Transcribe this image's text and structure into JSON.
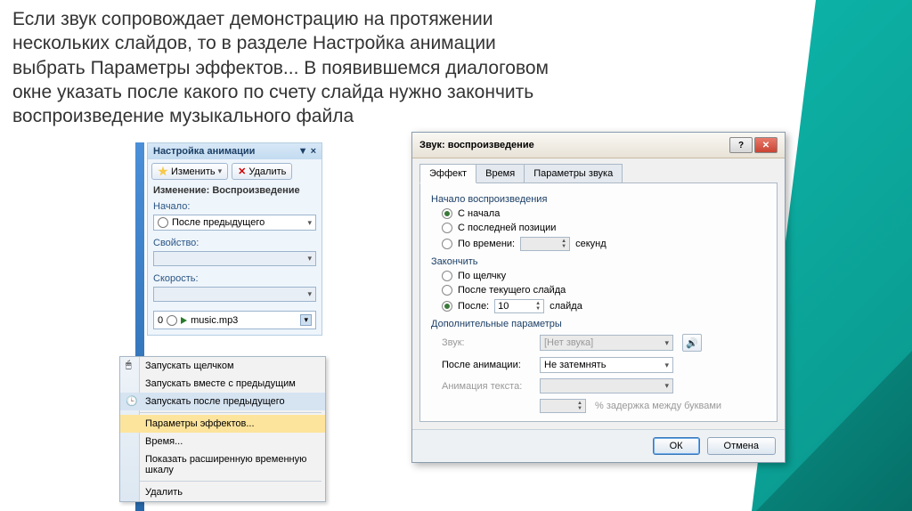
{
  "main_text": "Если звук сопровождает демонстрацию на протяжении нескольких слайдов, то в разделе Настройка анимации выбрать Параметры эффектов... В появившемся диалоговом окне указать после какого по счету слайда нужно закончить воспроизведение музыкального файла",
  "anim_pane": {
    "title": "Настройка анимации",
    "change_btn": "Изменить",
    "delete_btn": "Удалить",
    "section": "Изменение: Воспроизведение",
    "start_label": "Начало:",
    "start_value": "После предыдущего",
    "property_label": "Свойство:",
    "speed_label": "Скорость:",
    "item_index": "0",
    "item_name": "music.mp3"
  },
  "context_menu": {
    "items": [
      "Запускать щелчком",
      "Запускать вместе с предыдущим",
      "Запускать после предыдущего",
      "Параметры эффектов...",
      "Время...",
      "Показать расширенную временную шкалу",
      "Удалить"
    ]
  },
  "dialog": {
    "title": "Звук: воспроизведение",
    "tabs": [
      "Эффект",
      "Время",
      "Параметры звука"
    ],
    "start_section": "Начало воспроизведения",
    "opt_begin": "С начала",
    "opt_lastpos": "С последней позиции",
    "opt_time": "По времени:",
    "seconds": "секунд",
    "end_section": "Закончить",
    "opt_click": "По щелчку",
    "opt_curslide": "После текущего слайда",
    "opt_after": "После:",
    "after_value": "10",
    "slide_word": "слайда",
    "extra_section": "Дополнительные параметры",
    "sound_label": "Звук:",
    "sound_value": "[Нет звука]",
    "after_anim_label": "После анимации:",
    "after_anim_value": "Не затемнять",
    "text_anim_label": "Анимация текста:",
    "delay_label": "% задержка между буквами",
    "ok": "ОК",
    "cancel": "Отмена"
  }
}
